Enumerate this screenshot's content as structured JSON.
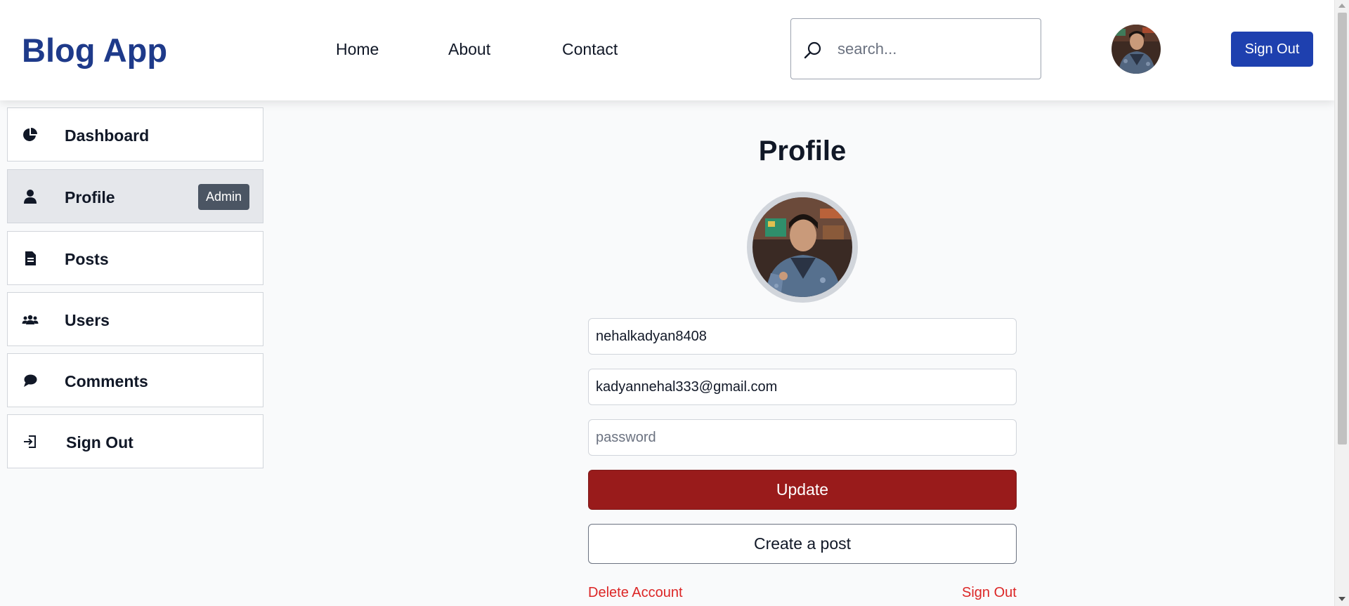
{
  "header": {
    "logo": "Blog App",
    "nav": [
      {
        "label": "Home"
      },
      {
        "label": "About"
      },
      {
        "label": "Contact"
      }
    ],
    "search": {
      "placeholder": "search..."
    },
    "sign_out_label": "Sign Out"
  },
  "sidebar": {
    "items": [
      {
        "label": "Dashboard",
        "icon": "pie-chart-icon"
      },
      {
        "label": "Profile",
        "icon": "user-icon",
        "badge": "Admin",
        "active": true
      },
      {
        "label": "Posts",
        "icon": "document-icon"
      },
      {
        "label": "Users",
        "icon": "users-icon"
      },
      {
        "label": "Comments",
        "icon": "chat-bubble-icon"
      },
      {
        "label": "Sign Out",
        "icon": "sign-out-icon"
      }
    ]
  },
  "main": {
    "title": "Profile",
    "username": {
      "value": "nehalkadyan8408"
    },
    "email": {
      "value": "kadyannehal333@gmail.com"
    },
    "password": {
      "value": "",
      "placeholder": "password"
    },
    "update_label": "Update",
    "create_post_label": "Create a post",
    "delete_account_label": "Delete Account",
    "sign_out_label": "Sign Out"
  },
  "colors": {
    "brand": "#1e3a8a",
    "primary_button": "#1e40af",
    "danger_button": "#991b1b",
    "danger_text": "#dc2626",
    "badge": "#4b5563"
  }
}
